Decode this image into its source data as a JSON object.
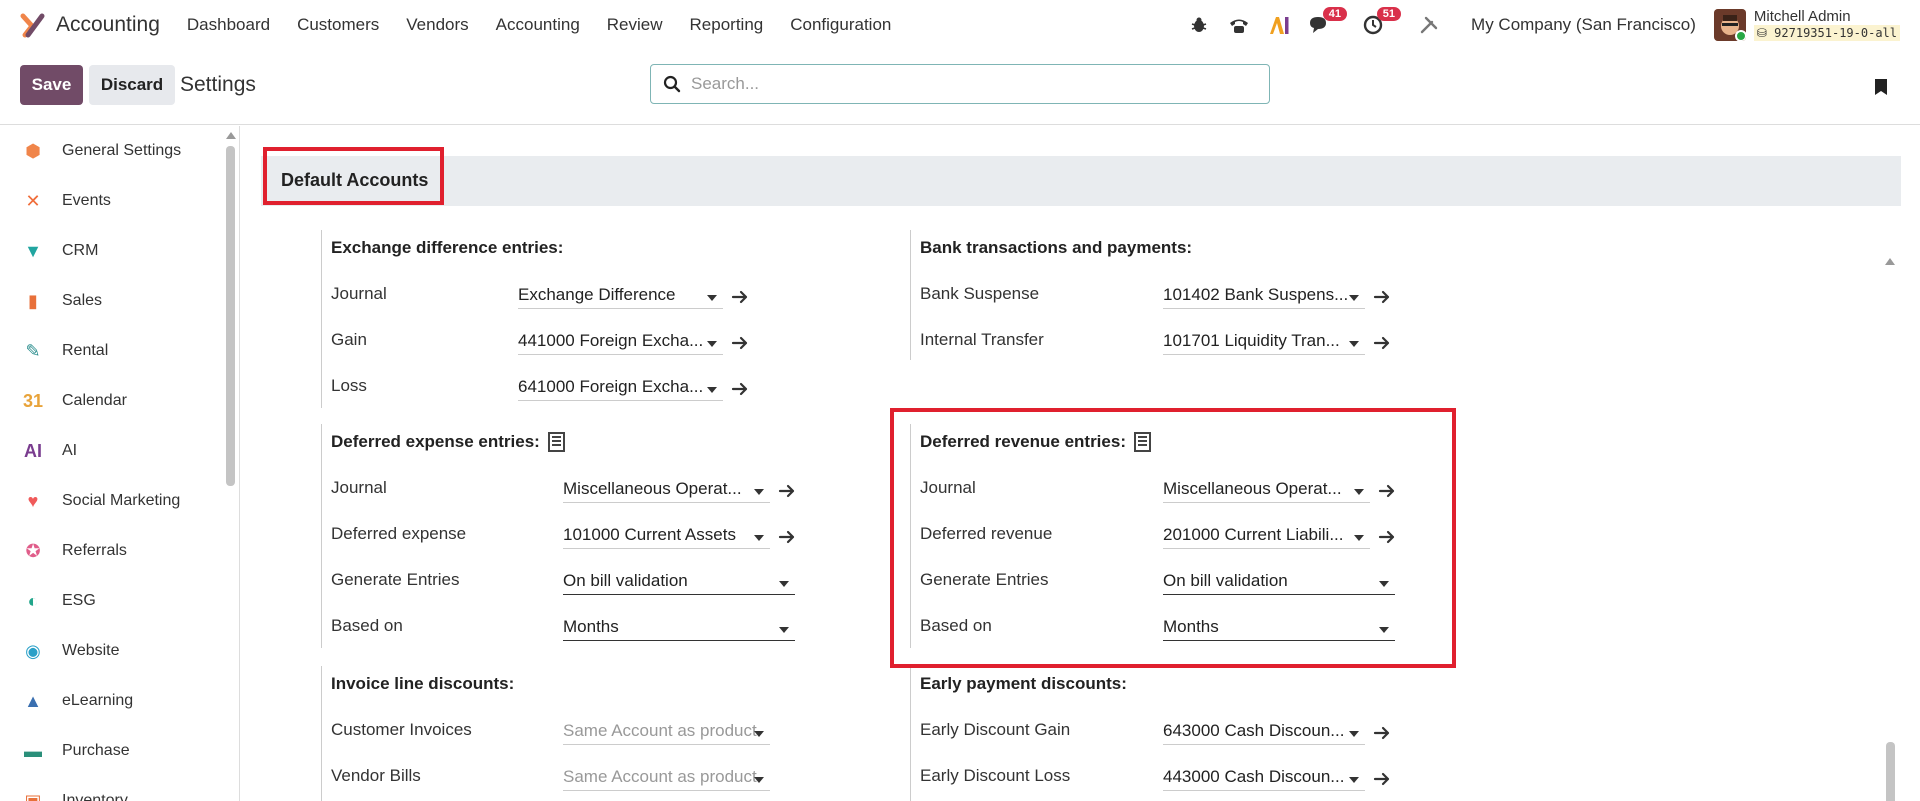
{
  "app": {
    "name": "Accounting",
    "menu": [
      "Dashboard",
      "Customers",
      "Vendors",
      "Accounting",
      "Review",
      "Reporting",
      "Configuration"
    ]
  },
  "systray": {
    "messages_count": "41",
    "activities_count": "51",
    "company": "My Company (San Francisco)",
    "user_name": "Mitchell Admin",
    "db_name": "92719351-19-0-all"
  },
  "control": {
    "save_label": "Save",
    "discard_label": "Discard",
    "title": "Settings",
    "search_placeholder": "Search..."
  },
  "sidebar": {
    "items": [
      {
        "label": "General Settings",
        "icon": "general-settings-icon",
        "color": "#f0854a"
      },
      {
        "label": "Events",
        "icon": "events-icon",
        "color": "#f06d3a"
      },
      {
        "label": "CRM",
        "icon": "crm-icon",
        "color": "#21a5a0"
      },
      {
        "label": "Sales",
        "icon": "sales-icon",
        "color": "#e8703a"
      },
      {
        "label": "Rental",
        "icon": "rental-icon",
        "color": "#2d8f8f"
      },
      {
        "label": "Calendar",
        "icon": "calendar-icon",
        "color": "#e8a33a"
      },
      {
        "label": "AI",
        "icon": "ai-icon",
        "color": "#7a3d8f"
      },
      {
        "label": "Social Marketing",
        "icon": "social-marketing-icon",
        "color": "#f05a5a"
      },
      {
        "label": "Referrals",
        "icon": "referrals-icon",
        "color": "#e05d8a"
      },
      {
        "label": "ESG",
        "icon": "esg-icon",
        "color": "#21a58a"
      },
      {
        "label": "Website",
        "icon": "website-icon",
        "color": "#2aa0c8"
      },
      {
        "label": "eLearning",
        "icon": "elearning-icon",
        "color": "#3a6fb0"
      },
      {
        "label": "Purchase",
        "icon": "purchase-icon",
        "color": "#2a8f7a"
      },
      {
        "label": "Inventory",
        "icon": "inventory-icon",
        "color": "#e8703a"
      }
    ]
  },
  "section": {
    "title": "Default Accounts"
  },
  "groups": {
    "exchange": {
      "title": "Exchange difference entries:",
      "rows": [
        {
          "label": "Journal",
          "value": "Exchange Difference"
        },
        {
          "label": "Gain",
          "value": "441000 Foreign Excha..."
        },
        {
          "label": "Loss",
          "value": "641000 Foreign Excha..."
        }
      ]
    },
    "bank": {
      "title": "Bank transactions and payments:",
      "rows": [
        {
          "label": "Bank Suspense",
          "value": "101402 Bank Suspens..."
        },
        {
          "label": "Internal Transfer",
          "value": "101701 Liquidity Tran..."
        }
      ]
    },
    "deferred_expense": {
      "title": "Deferred expense entries:",
      "rows": [
        {
          "label": "Journal",
          "value": "Miscellaneous Operat..."
        },
        {
          "label": "Deferred expense",
          "value": "101000 Current Assets"
        },
        {
          "label": "Generate Entries",
          "value": "On bill validation"
        },
        {
          "label": "Based on",
          "value": "Months"
        }
      ]
    },
    "deferred_revenue": {
      "title": "Deferred revenue entries:",
      "rows": [
        {
          "label": "Journal",
          "value": "Miscellaneous Operat..."
        },
        {
          "label": "Deferred revenue",
          "value": "201000 Current Liabili..."
        },
        {
          "label": "Generate Entries",
          "value": "On bill validation"
        },
        {
          "label": "Based on",
          "value": "Months"
        }
      ]
    },
    "invoice_discounts": {
      "title": "Invoice line discounts:",
      "rows": [
        {
          "label": "Customer Invoices",
          "value": "Same Account as product"
        },
        {
          "label": "Vendor Bills",
          "value": "Same Account as product"
        }
      ]
    },
    "early_discounts": {
      "title": "Early payment discounts:",
      "rows": [
        {
          "label": "Early Discount Gain",
          "value": "643000 Cash Discoun..."
        },
        {
          "label": "Early Discount Loss",
          "value": "443000 Cash Discoun..."
        }
      ]
    }
  },
  "colors": {
    "brand": "#714b67",
    "highlight": "#e0202e",
    "badge": "#d9304a"
  }
}
